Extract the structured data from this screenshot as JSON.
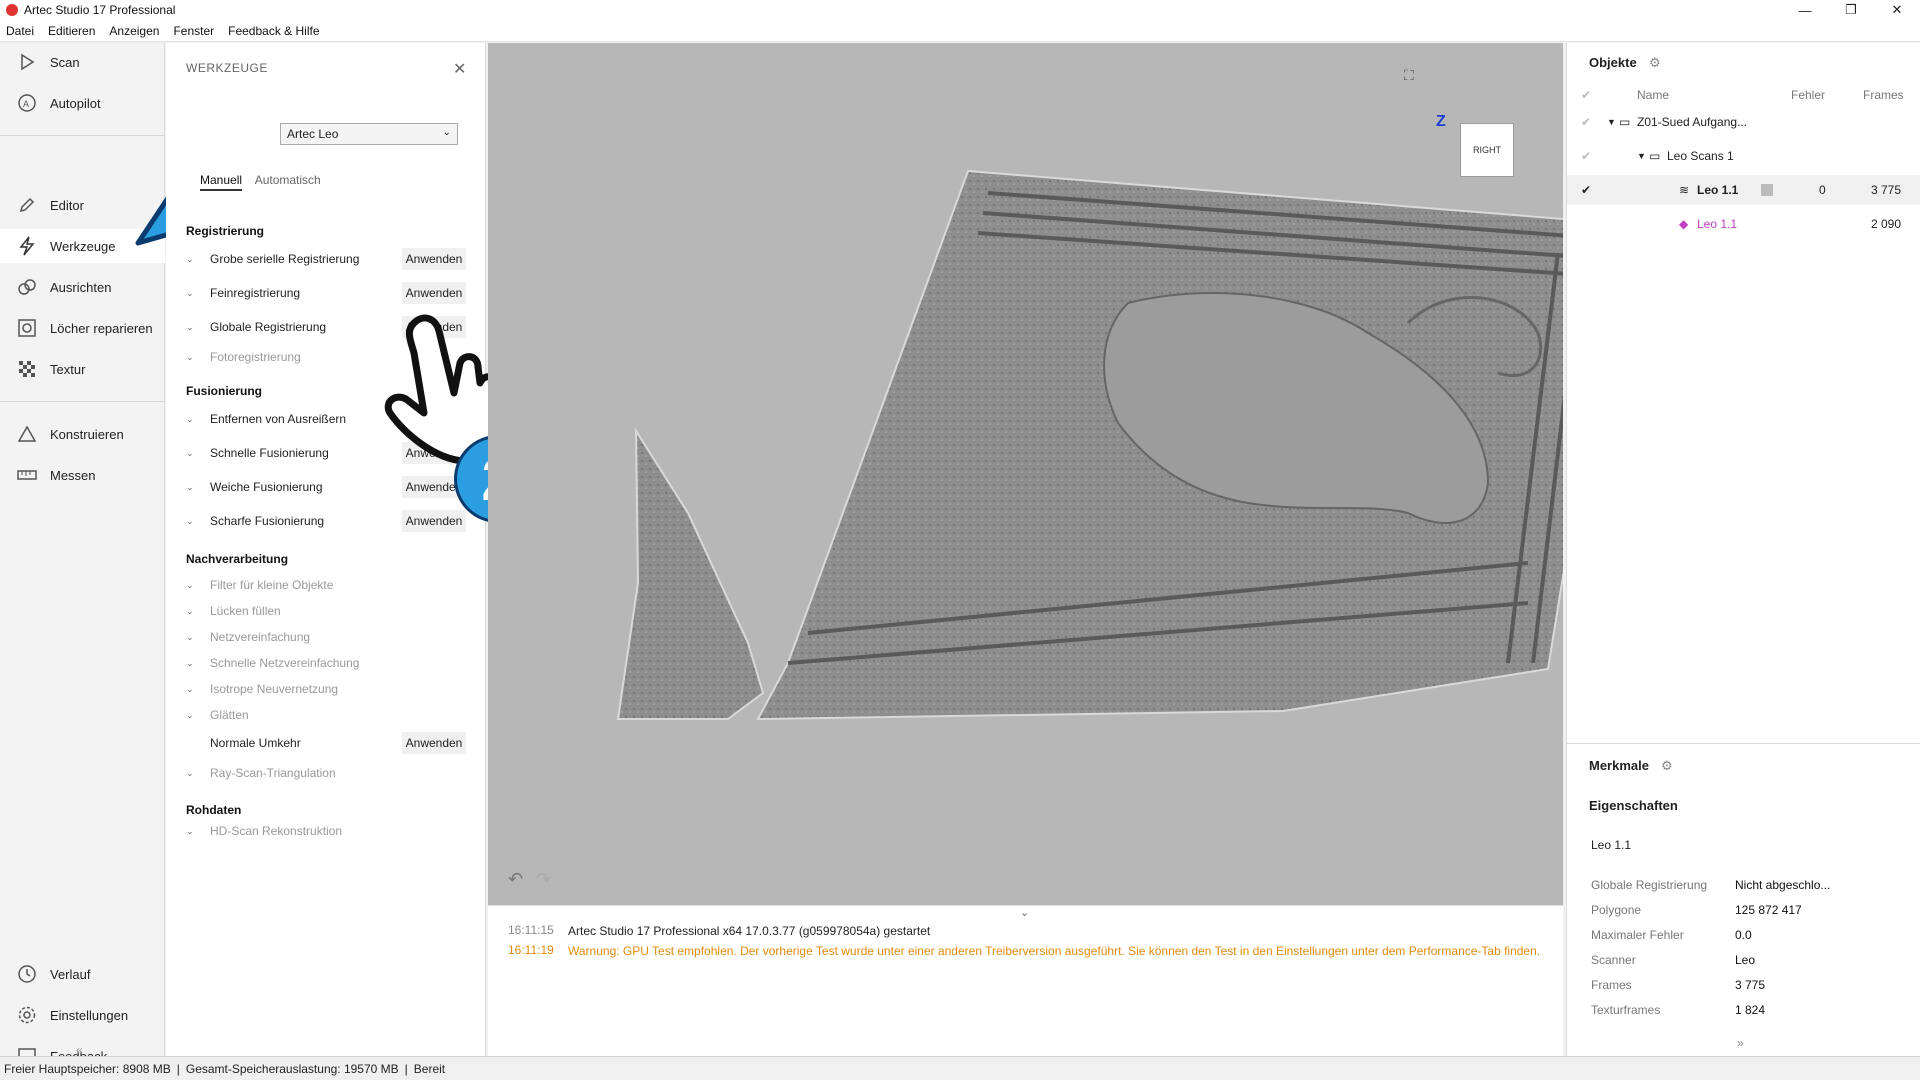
{
  "window": {
    "title": "Artec Studio 17 Professional"
  },
  "menu": [
    "Datei",
    "Editieren",
    "Anzeigen",
    "Fenster",
    "Feedback & Hilfe"
  ],
  "nav": {
    "scan": "Scan",
    "autopilot": "Autopilot",
    "editor": "Editor",
    "werkzeuge": "Werkzeuge",
    "ausrichten": "Ausrichten",
    "loecher": "Löcher reparieren",
    "textur": "Textur",
    "konstruieren": "Konstruieren",
    "messen": "Messen",
    "verlauf": "Verlauf",
    "einstellungen": "Einstellungen",
    "feedback": "Feedback",
    "collapse": "«"
  },
  "tools": {
    "header": "WERKZEUGE",
    "scanner": "Artec Leo",
    "mode_manual": "Manuell",
    "mode_auto": "Automatisch",
    "apply": "Anwenden",
    "sections": {
      "registrierung": "Registrierung",
      "fusionierung": "Fusionierung",
      "nachverarbeitung": "Nachverarbeitung",
      "rohdaten": "Rohdaten"
    },
    "items": {
      "grobe": "Grobe serielle Registrierung",
      "fein": "Feinregistrierung",
      "global": "Globale Registrierung",
      "foto": "Fotoregistrierung",
      "ausreisser": "Entfernen von Ausreißern",
      "schnelle": "Schnelle Fusionierung",
      "weiche": "Weiche Fusionierung",
      "scharfe": "Scharfe Fusionierung",
      "filter": "Filter für kleine Objekte",
      "luecken": "Lücken füllen",
      "netzvereinfachung": "Netzvereinfachung",
      "schnelle_netz": "Schnelle Netzvereinfachung",
      "isotrope": "Isotrope Neuvernetzung",
      "glaetten": "Glätten",
      "normale": "Normale Umkehr",
      "ray": "Ray-Scan-Triangulation",
      "hd": "HD-Scan Rekonstruktion"
    }
  },
  "viewport": {
    "axis_z": "Z",
    "cube_label": "RIGHT",
    "overlay_number": "2"
  },
  "console": {
    "collapse": "⌄",
    "line1_time": "16:11:15",
    "line1_msg": "Artec Studio 17 Professional x64 17.0.3.77 (g059978054a) gestartet",
    "line2_time": "16:11:19",
    "line2_msg": "Warnung: GPU Test empfohlen. Der vorherige Test wurde unter einer anderen Treiberversion ausgeführt. Sie können den Test in den Einstellungen unter dem Performance-Tab finden."
  },
  "objects": {
    "title": "Objekte",
    "col_name": "Name",
    "col_error": "Fehler",
    "col_frames": "Frames",
    "rows": [
      {
        "name": "Z01-Sued Aufgang...",
        "error": "",
        "frames": ""
      },
      {
        "name": "Leo Scans 1",
        "error": "",
        "frames": ""
      },
      {
        "name": "Leo 1.1",
        "error": "0",
        "frames": "3 775"
      },
      {
        "name": "Leo 1.1",
        "error": "",
        "frames": "2 090"
      }
    ]
  },
  "features": {
    "title": "Merkmale",
    "props_title": "Eigenschaften",
    "object_name": "Leo 1.1",
    "props": [
      {
        "label": "Globale Registrierung",
        "value": "Nicht abgeschlo..."
      },
      {
        "label": "Polygone",
        "value": "125 872 417"
      },
      {
        "label": "Maximaler Fehler",
        "value": "0.0"
      },
      {
        "label": "Scanner",
        "value": "Leo"
      },
      {
        "label": "Frames",
        "value": "3 775"
      },
      {
        "label": "Texturframes",
        "value": "1 824"
      }
    ],
    "expand": "»"
  },
  "status": {
    "free_mem": "Freier Hauptspeicher: 8908 MB",
    "total_mem": "Gesamt-Speicherauslastung: 19570 MB",
    "state": "Bereit"
  },
  "colors": {
    "accent_blue": "#2a9ee0",
    "warning": "#e08a10",
    "mesh_color": "#8a8a8a",
    "texture_mesh_pink": "#c040c0"
  }
}
